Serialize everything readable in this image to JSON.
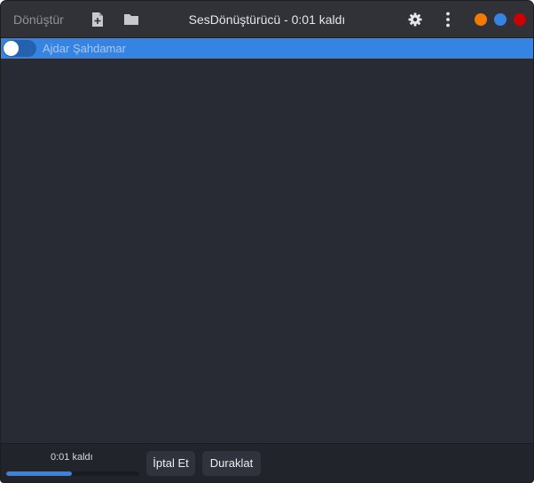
{
  "header": {
    "convert_label": "Dönüştür",
    "add_file_icon": "document-new-icon",
    "add_folder_icon": "folder-icon",
    "title": "SesDönüştürücü - 0:01 kaldı",
    "settings_icon": "gear-icon",
    "menu_icon": "vertical-dots-icon",
    "window_controls": {
      "minimize_color": "#f57900",
      "maximize_color": "#3584e4",
      "close_color": "#cc0000"
    }
  },
  "list": {
    "items": [
      {
        "label": "Ajdar Şahdamar",
        "enabled": true
      }
    ],
    "selected_color": "#3584e4"
  },
  "footer": {
    "time_left": "0:01 kaldı",
    "progress": 0.49,
    "cancel_label": "İptal Et",
    "pause_label": "Duraklat"
  }
}
